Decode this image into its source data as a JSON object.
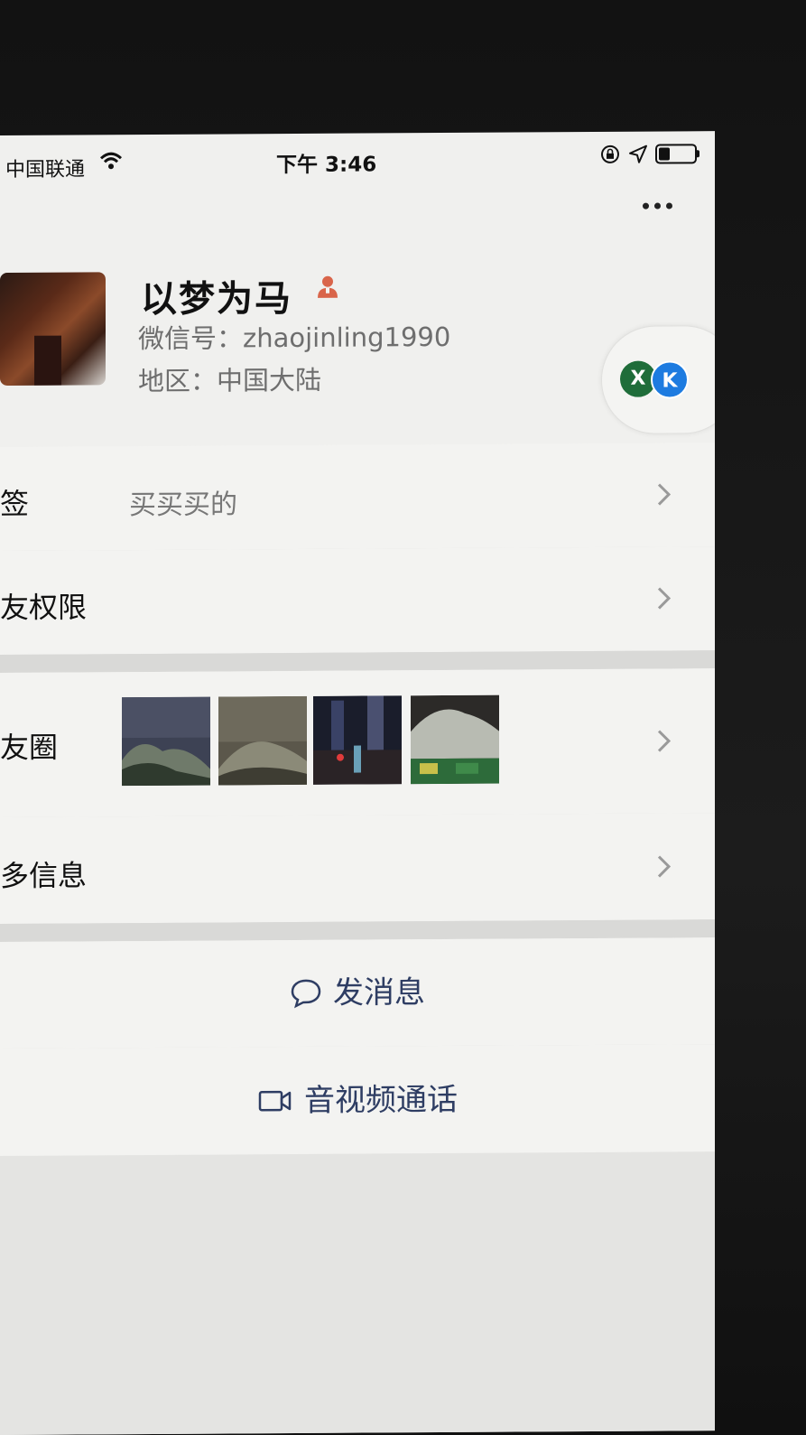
{
  "status_bar": {
    "carrier": "中国联通",
    "time": "下午 3:46"
  },
  "profile": {
    "nickname": "以梦为马",
    "wechat_id": "微信号：zhaojinling1990",
    "region": "地区：中国大陆",
    "badge_icon": "person-icon",
    "pill_icons": [
      "x-app-icon",
      "k-app-icon"
    ]
  },
  "rows": {
    "tags": {
      "label": "签",
      "value": "买买买的"
    },
    "permissions": {
      "label": "友权限"
    },
    "moments": {
      "label": "友圈"
    },
    "more_info": {
      "label": "多信息"
    }
  },
  "actions": {
    "message": "发消息",
    "call": "音视频通话"
  },
  "colors": {
    "action_text": "#2e3d63",
    "background": "#f3f3f1",
    "separator": "#d9d9d7"
  }
}
